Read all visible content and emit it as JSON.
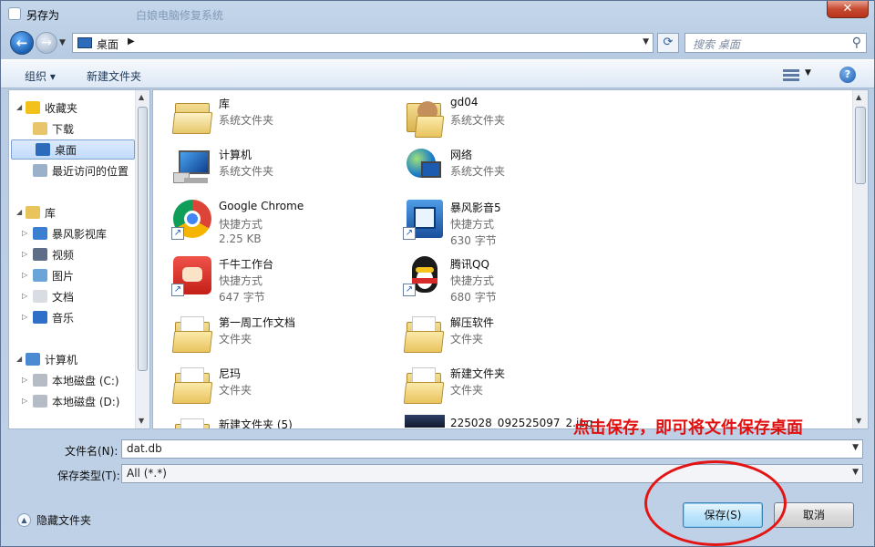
{
  "window": {
    "title": "另存为",
    "background_title": "白娘电脑修复系统"
  },
  "address": {
    "location": "桌面",
    "search_placeholder": "搜索 桌面"
  },
  "toolbar": {
    "organize": "组织 ▾",
    "new_folder": "新建文件夹"
  },
  "nav_tree": [
    {
      "label": "收藏夹",
      "icon": "star-icon",
      "twist": "◢"
    },
    {
      "label": "下载",
      "icon": "download-folder-icon"
    },
    {
      "label": "桌面",
      "icon": "desktop-icon",
      "selected": true
    },
    {
      "label": "最近访问的位置",
      "icon": "recent-places-icon"
    },
    {
      "label": "库",
      "icon": "library-icon",
      "twist": "◢"
    },
    {
      "label": "暴风影视库",
      "icon": "video-library-icon",
      "twist": "▷"
    },
    {
      "label": "视频",
      "icon": "video-icon",
      "twist": "▷"
    },
    {
      "label": "图片",
      "icon": "picture-icon",
      "twist": "▷"
    },
    {
      "label": "文档",
      "icon": "document-icon",
      "twist": "▷"
    },
    {
      "label": "音乐",
      "icon": "music-icon",
      "twist": "▷"
    },
    {
      "label": "计算机",
      "icon": "computer-icon",
      "twist": "◢"
    },
    {
      "label": "本地磁盘 (C:)",
      "icon": "drive-c-icon",
      "twist": "▷"
    },
    {
      "label": "本地磁盘 (D:)",
      "icon": "drive-d-icon",
      "twist": "▷"
    }
  ],
  "files": [
    {
      "name": "库",
      "type": "系统文件夹",
      "icon": "library-icon"
    },
    {
      "name": "gd04",
      "type": "系统文件夹",
      "icon": "user-folder-icon"
    },
    {
      "name": "计算机",
      "type": "系统文件夹",
      "icon": "computer-icon"
    },
    {
      "name": "网络",
      "type": "系统文件夹",
      "icon": "network-icon"
    },
    {
      "name": "Google Chrome",
      "type": "快捷方式",
      "size": "2.25 KB",
      "icon": "chrome-icon"
    },
    {
      "name": "暴风影音5",
      "type": "快捷方式",
      "size": "630 字节",
      "icon": "baofeng-icon"
    },
    {
      "name": "千牛工作台",
      "type": "快捷方式",
      "size": "647 字节",
      "icon": "qianniu-icon"
    },
    {
      "name": "腾讯QQ",
      "type": "快捷方式",
      "size": "680 字节",
      "icon": "qq-icon"
    },
    {
      "name": "第一周工作文档",
      "type": "文件夹",
      "icon": "folder-icon"
    },
    {
      "name": "解压软件",
      "type": "文件夹",
      "icon": "folder-icon"
    },
    {
      "name": "尼玛",
      "type": "文件夹",
      "icon": "folder-icon"
    },
    {
      "name": "新建文件夹",
      "type": "文件夹",
      "icon": "folder-icon"
    },
    {
      "name": "新建文件夹 (5)",
      "type": "",
      "icon": "folder-icon"
    },
    {
      "name": "225028_092525097_2.jpg",
      "type": "",
      "icon": "image-file-icon"
    }
  ],
  "form": {
    "filename_label": "文件名(N):",
    "filename_value": "dat.db",
    "filetype_label": "保存类型(T):",
    "filetype_value": "All (*.*)",
    "hide_folders": "隐藏文件夹",
    "save": "保存(S)",
    "cancel": "取消"
  },
  "annotation": {
    "text": "点击保存，即可将文件保存桌面",
    "color": "#e01010"
  }
}
